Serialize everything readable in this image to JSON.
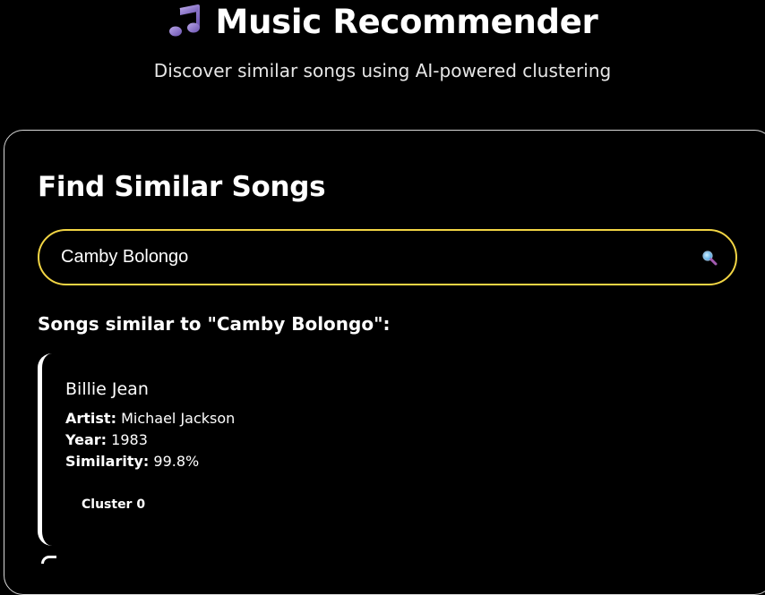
{
  "app": {
    "title": "Music Recommender",
    "subtitle": "Discover similar songs using AI-powered clustering",
    "icon": "musical-note-icon"
  },
  "search": {
    "section_title": "Find Similar Songs",
    "value": "Camby Bolongo",
    "icon": "search-icon",
    "border_color": "#f2d544"
  },
  "results": {
    "heading": "Songs similar to \"Camby Bolongo\":",
    "items": [
      {
        "title": "Billie Jean",
        "artist_label": "Artist:",
        "artist": "Michael Jackson",
        "year_label": "Year:",
        "year": "1983",
        "similarity_label": "Similarity:",
        "similarity": "99.8%",
        "cluster": "Cluster 0"
      }
    ]
  }
}
